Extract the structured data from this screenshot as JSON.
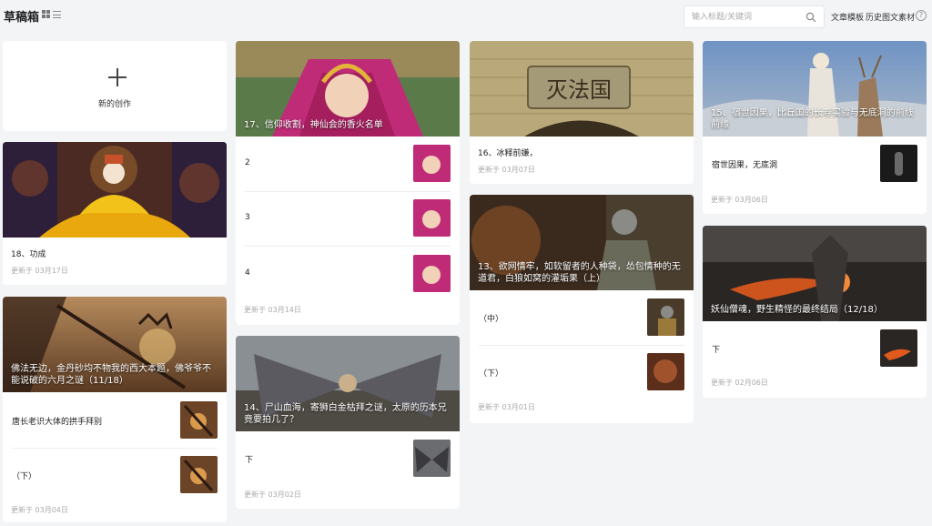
{
  "header": {
    "title": "草稿箱",
    "search_placeholder": "输入标题/关键词",
    "link_templates": "文章模板",
    "link_history": "历史图文素材",
    "help": "?"
  },
  "new_card": {
    "label": "新的创作",
    "icon": "plus-icon"
  },
  "cards": {
    "c18": {
      "cover_title": "",
      "name": "18、功成",
      "updated": "更新于 03月17日"
    },
    "c11": {
      "cover_title": "佛法无边，金丹砂均不物我的西大本题，佛爷爷不能说破的六月之谜（11/18）",
      "rows": [
        {
          "label": "唐长老识大体的拱手拜别"
        },
        {
          "label": "（下）"
        }
      ],
      "updated": "更新于 03月04日"
    },
    "c17": {
      "cover_title": "17、信仰收割，神仙会的香火名单",
      "rows": [
        {
          "label": "2"
        },
        {
          "label": "3"
        },
        {
          "label": "4"
        }
      ],
      "updated": "更新于 03月14日"
    },
    "c14": {
      "cover_title": "14、尸山血海，寄狮白金枯拜之谜，太原的历本兄竟要拍几了？",
      "rows": [
        {
          "label": "下"
        }
      ],
      "updated": "更新于 03月02日"
    },
    "c16": {
      "cover_title": "",
      "name": "16、冰释前嫌，",
      "updated": "更新于 03月07日"
    },
    "c13": {
      "cover_title": "13、欲网情牢，如软留者的人种袋，怂包情种的无道君，白狼如窝的灌垢果（上）",
      "rows": [
        {
          "label": "（中）"
        },
        {
          "label": "（下）"
        }
      ],
      "updated": "更新于 03月01日"
    },
    "c15": {
      "cover_title": "15、宿世因果，比丘国的长寿实验与无底洞的前线前缘",
      "rows": [
        {
          "label": "宿世因果，无底洞"
        }
      ],
      "updated": "更新于 03月06日"
    },
    "c12": {
      "cover_title": "妖仙僧魂，野生精怪的最终结局（12/18）",
      "rows": [
        {
          "label": "下"
        }
      ],
      "updated": "更新于 02月06日"
    }
  },
  "gate_plaque": "灭法国",
  "colors": {
    "bg": "#f3f4f6",
    "card": "#ffffff",
    "muted": "#aaaaaa"
  }
}
